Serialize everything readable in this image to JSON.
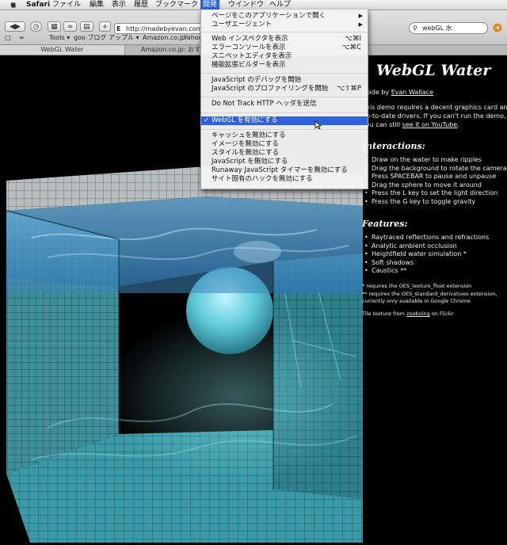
{
  "menubar": {
    "app": "Safari",
    "items": [
      "ファイル",
      "編集",
      "表示",
      "履歴",
      "ブックマーク",
      "開発",
      "ウインドウ",
      "ヘルプ"
    ],
    "active_item": "開発"
  },
  "toolbar": {
    "url": "http://madebyevan.com/w",
    "search_value": "webGL 水",
    "bookmarks": [
      "Tools ▾",
      "goo ブログ",
      "アップル ▾",
      "Amazon.co.jp",
      "Yahoo"
    ]
  },
  "tabs": [
    "WebGL Water",
    "Amazon.co.jp: おす"
  ],
  "dev_menu": {
    "groups": [
      [
        {
          "label": "ページをこのアプリケーションで開く",
          "shortcut": "",
          "submenu": true
        },
        {
          "label": "ユーザエージェント",
          "shortcut": "",
          "submenu": true
        }
      ],
      [
        {
          "label": "Web インスペクタを表示",
          "shortcut": "⌥⌘I"
        },
        {
          "label": "エラーコンソールを表示",
          "shortcut": "⌥⌘C"
        },
        {
          "label": "スニペットエディタを表示",
          "shortcut": ""
        },
        {
          "label": "機能拡張ビルダーを表示",
          "shortcut": ""
        }
      ],
      [
        {
          "label": "JavaScript のデバッグを開始",
          "shortcut": ""
        },
        {
          "label": "JavaScript のプロファイリングを開始",
          "shortcut": "⌥⇧⌘P"
        }
      ],
      [
        {
          "label": "Do Not Track HTTP ヘッダを送信",
          "shortcut": ""
        }
      ],
      [
        {
          "label": "WebGL を有効にする",
          "shortcut": "",
          "checked": true,
          "highlighted": true
        }
      ],
      [
        {
          "label": "キャッシュを無効にする",
          "shortcut": ""
        },
        {
          "label": "イメージを無効にする",
          "shortcut": ""
        },
        {
          "label": "スタイルを無効にする",
          "shortcut": ""
        },
        {
          "label": "JavaScript を無効にする",
          "shortcut": ""
        },
        {
          "label": "Runaway JavaScript タイマーを無効にする",
          "shortcut": ""
        },
        {
          "label": "サイト固有のハックを無効にする",
          "shortcut": ""
        }
      ]
    ]
  },
  "page": {
    "title": "WebGL Water",
    "author_prefix": "Made by",
    "author": "Evan Wallace",
    "intro": [
      "This demo requires a decent graphics card and",
      "up-to-date drivers. If you can't run the demo,",
      "you can still"
    ],
    "intro_link": "see it on YouTube",
    "intro_tail": ".",
    "interactions_heading": "Interactions:",
    "interactions": [
      "Draw on the water to make ripples",
      "Drag the background to rotate the camera",
      "Press SPACEBAR to pause and unpause",
      "Drag the sphere to move it around",
      "Press the L key to set the light direction",
      "Press the G key to toggle gravity"
    ],
    "features_heading": "Features:",
    "features": [
      "Raytraced reflections and refractions",
      "Analytic ambient occlusion",
      "Heightfield water simulation *",
      "Soft shadows",
      "Caustics **"
    ],
    "footnotes": [
      "* requires the OES_texture_float extension",
      "** requires the OES_standard_derivatives extension,",
      "currently only available in Google Chrome"
    ],
    "credit_prefix": "Tile texture from",
    "credit_link": "zooboing",
    "credit_suffix": "on Flickr"
  },
  "colors": {
    "menu_highlight": "#2f62d8",
    "water": "#4a9ac8",
    "tile": "#3d8f9a"
  }
}
